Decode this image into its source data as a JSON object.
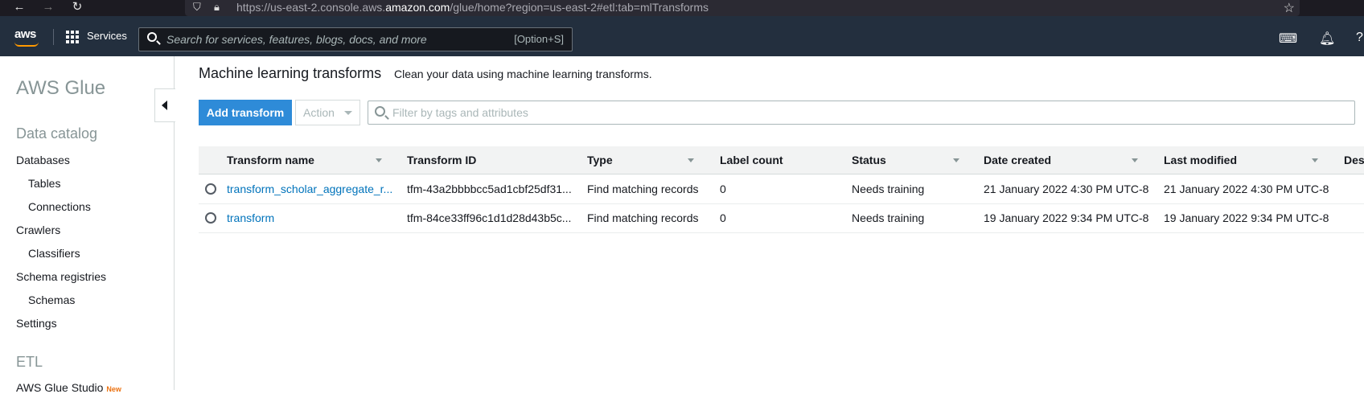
{
  "browser": {
    "url_prefix": "https://us-east-2.console.aws.",
    "url_domain": "amazon.com",
    "url_suffix": "/glue/home?region=us-east-2#etl:tab=mlTransforms",
    "back_icon": "arrow-left-icon",
    "forward_icon": "arrow-right-icon",
    "reload_icon": "reload-icon"
  },
  "topnav": {
    "logo": "aws",
    "services_label": "Services",
    "search_placeholder": "Search for services, features, blogs, docs, and more",
    "search_shortcut": "[Option+S]"
  },
  "sidebar": {
    "title": "AWS Glue",
    "data_catalog": "Data catalog",
    "items": [
      {
        "label": "Databases"
      },
      {
        "label": "Tables"
      },
      {
        "label": "Connections"
      },
      {
        "label": "Crawlers"
      },
      {
        "label": "Classifiers"
      },
      {
        "label": "Schema registries"
      },
      {
        "label": "Schemas"
      },
      {
        "label": "Settings"
      }
    ],
    "etl": "ETL",
    "glue_studio": "AWS Glue Studio",
    "new_badge": "New"
  },
  "main": {
    "title": "Machine learning transforms",
    "description": "Clean your data using machine learning transforms.",
    "add_button": "Add transform",
    "action_button": "Action",
    "filter_placeholder": "Filter by tags and attributes",
    "columns": [
      "Transform name",
      "Transform ID",
      "Type",
      "Label count",
      "Status",
      "Date created",
      "Last modified",
      "Des"
    ],
    "rows": [
      {
        "name": "transform_scholar_aggregate_r...",
        "id": "tfm-43a2bbbbcc5ad1cbf25df31...",
        "type": "Find matching records",
        "label_count": "0",
        "status": "Needs training",
        "created": "21 January 2022 4:30 PM UTC-8",
        "modified": "21 January 2022 4:30 PM UTC-8"
      },
      {
        "name": "transform",
        "id": "tfm-84ce33ff96c1d1d28d43b5c...",
        "type": "Find matching records",
        "label_count": "0",
        "status": "Needs training",
        "created": "19 January 2022 9:34 PM UTC-8",
        "modified": "19 January 2022 9:34 PM UTC-8"
      }
    ]
  },
  "colors": {
    "nav_bg": "#232f3e",
    "primary": "#2e8bd8",
    "link": "#0073bb",
    "accent": "#ff9900"
  }
}
